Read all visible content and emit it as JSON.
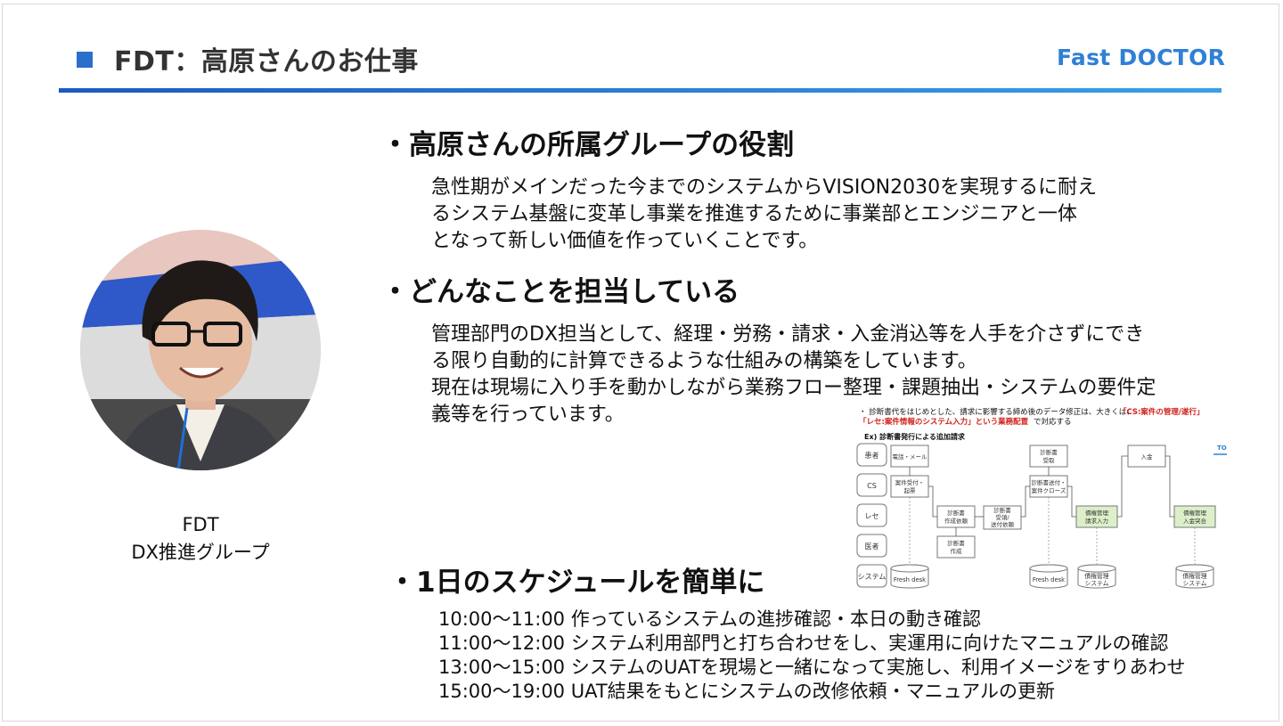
{
  "header": {
    "title": "FDT：高原さんのお仕事",
    "logo": "Fast DOCTOR"
  },
  "profile": {
    "team_line1": "FDT",
    "team_line2": "DX推進グループ"
  },
  "sections": [
    {
      "heading": "・高原さんの所属グループの役割",
      "lines": [
        "急性期がメインだった今までのシステムからVISION2030を実現するに耐え",
        "るシステム基盤に変革し事業を推進するために事業部とエンジニアと一体",
        "となって新しい価値を作っていくことです。"
      ]
    },
    {
      "heading": "・どんなことを担当している",
      "lines": [
        "管理部門のDX担当として、経理・労務・請求・入金消込等を人手を介さずにでき",
        "る限り自動的に計算できるような仕組みの構築をしています。",
        "現在は現場に入り手を動かしながら業務フロー整理・課題抽出・システムの要件定",
        "義等を行っています。"
      ]
    },
    {
      "heading": "・1日のスケジュールを簡単に",
      "lines": [
        "10:00〜11:00 作っているシステムの進捗確認・本日の動き確認",
        "11:00〜12:00 システム利用部門と打ち合わせをし、実運用に向けたマニュアルの確認",
        "13:00〜15:00 システムのUATを現場と一緒になって実施し、利用イメージをすりあわせ",
        "15:00〜19:00 UAT結果をもとにシステムの改修依頼・マニュアルの更新"
      ]
    }
  ],
  "embedded_diagram": {
    "note_prefix": "・ 診断書代をはじめとした、請求に影響する締め後のデータ修正は、大きくは、",
    "note_red1": "「CS:案件の管理/遂行」",
    "note_red2": "「レセ:案件情報のシステム入力」という業務配置",
    "note_suffix": "で対応する",
    "subtitle": "Ex) 診断書発行による追加請求",
    "logo_fragment": "TOR",
    "lanes": [
      "患者",
      "CS",
      "レセ",
      "医者",
      "システム"
    ],
    "boxes": {
      "b1": "電話・メール",
      "b2a": "案件受付・",
      "b2b": "起票",
      "b3a": "診断書",
      "b3b": "作成依頼",
      "b4a": "診断書",
      "b4b": "作成",
      "b5a": "診断書",
      "b5b": "受領/",
      "b5c": "送付依頼",
      "b6a": "診断書",
      "b6b": "受取",
      "b7a": "診断書送付・",
      "b7b": "案件クローズ",
      "b8a": "債権管理",
      "b8b": "請求入力",
      "b9": "入金",
      "b10a": "債権管理",
      "b10b": "入金突合"
    },
    "systems": {
      "s1": "Fresh desk",
      "s2": "Fresh desk",
      "s3a": "債権管理",
      "s3b": "システム",
      "s4a": "債権管理",
      "s4b": "システム"
    },
    "colors": {
      "accent_red": "#d0201a",
      "green_box": "#dcefc9"
    }
  },
  "colors": {
    "brand_blue": "#2f80d6",
    "rule_blue": "#1c59c4"
  },
  "icons": {
    "title_marker": "square-bullet-icon",
    "photo": "profile-photo"
  }
}
